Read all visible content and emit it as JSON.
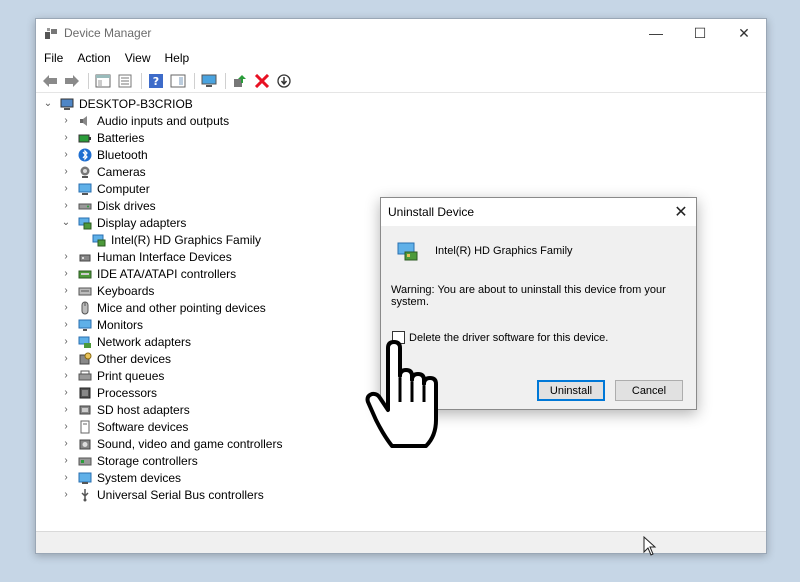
{
  "window": {
    "title": "Device Manager",
    "controls": {
      "minimize": "—",
      "maximize": "☐",
      "close": "✕"
    }
  },
  "menu": [
    "File",
    "Action",
    "View",
    "Help"
  ],
  "tree": {
    "root": "DESKTOP-B3CRIOB",
    "categories": [
      {
        "label": "Audio inputs and outputs",
        "icon": "speaker-icon"
      },
      {
        "label": "Batteries",
        "icon": "battery-icon"
      },
      {
        "label": "Bluetooth",
        "icon": "bluetooth-icon"
      },
      {
        "label": "Cameras",
        "icon": "camera-icon"
      },
      {
        "label": "Computer",
        "icon": "computer-icon"
      },
      {
        "label": "Disk drives",
        "icon": "disk-icon"
      },
      {
        "label": "Display adapters",
        "icon": "display-adapter-icon",
        "expanded": true,
        "children": [
          "Intel(R) HD Graphics Family"
        ]
      },
      {
        "label": "Human Interface Devices",
        "icon": "hid-icon"
      },
      {
        "label": "IDE ATA/ATAPI controllers",
        "icon": "ide-icon"
      },
      {
        "label": "Keyboards",
        "icon": "keyboard-icon"
      },
      {
        "label": "Mice and other pointing devices",
        "icon": "mouse-icon"
      },
      {
        "label": "Monitors",
        "icon": "monitor-icon"
      },
      {
        "label": "Network adapters",
        "icon": "network-icon"
      },
      {
        "label": "Other devices",
        "icon": "other-devices-icon"
      },
      {
        "label": "Print queues",
        "icon": "printer-icon"
      },
      {
        "label": "Processors",
        "icon": "processor-icon"
      },
      {
        "label": "SD host adapters",
        "icon": "sd-card-icon"
      },
      {
        "label": "Software devices",
        "icon": "software-icon"
      },
      {
        "label": "Sound, video and game controllers",
        "icon": "sound-icon"
      },
      {
        "label": "Storage controllers",
        "icon": "storage-icon"
      },
      {
        "label": "System devices",
        "icon": "system-icon"
      },
      {
        "label": "Universal Serial Bus controllers",
        "icon": "usb-icon"
      }
    ]
  },
  "dialog": {
    "title": "Uninstall Device",
    "device_name": "Intel(R) HD Graphics Family",
    "warning": "Warning: You are about to uninstall this device from your system.",
    "checkbox_label": "Delete the driver software for this device.",
    "checkbox_checked": false,
    "uninstall_label": "Uninstall",
    "cancel_label": "Cancel",
    "close_glyph": "✕"
  },
  "colors": {
    "desktop": "#c6d6e6",
    "accent": "#0078d7",
    "delete_red": "#e81123"
  }
}
